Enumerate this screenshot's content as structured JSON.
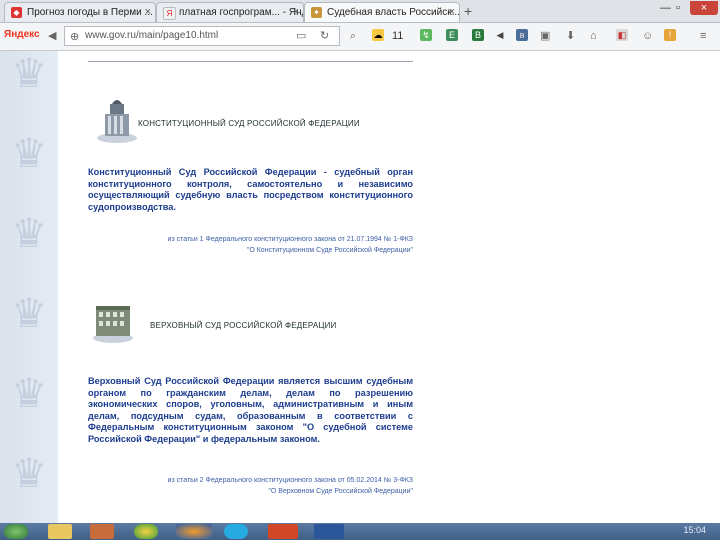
{
  "tabs": [
    {
      "title": "Прогноз погоды в Перми ...",
      "active": false
    },
    {
      "title": "платная госпрограм... - Янд...",
      "active": false
    },
    {
      "title": "Судебная власть Российск...",
      "active": true
    }
  ],
  "toolbar": {
    "brand": "Яндекс",
    "url": "www.gov.ru/main/page10.html",
    "weather_temp": "11"
  },
  "page": {
    "courts": [
      {
        "title": "КОНСТИТУЦИОННЫЙ СУД РОССИЙСКОЙ ФЕДЕРАЦИИ",
        "description": "Конституционный Суд Российской Федерации - судебный орган конституционного контроля, самостоятельно и независимо осуществляющий судебную власть посредством конституционного судопроизводства.",
        "citation_line1": "из статьи 1 Федерального конституционного закона от 21.07.1994 № 1-ФКЗ",
        "citation_line2": "\"О Конституционном Суде Российской Федерации\""
      },
      {
        "title": "ВЕРХОВНЫЙ СУД РОССИЙСКОЙ ФЕДЕРАЦИИ",
        "description": "Верховный Суд Российской Федерации является высшим судебным органом по гражданским делам, делам по разрешению экономических споров, уголовным, административным и иным делам, подсудным судам, образованным в соответствии с Федеральным конституционным законом \"О судебной системе Российской Федерации\" и федеральным законом.",
        "citation_line1": "из статьи 2 Федерального конституционного закона от 05.02.2014 № 3-ФКЗ",
        "citation_line2": "\"О Верховном Суде Российской Федерации\""
      }
    ]
  },
  "taskbar": {
    "clock": "15:04"
  }
}
